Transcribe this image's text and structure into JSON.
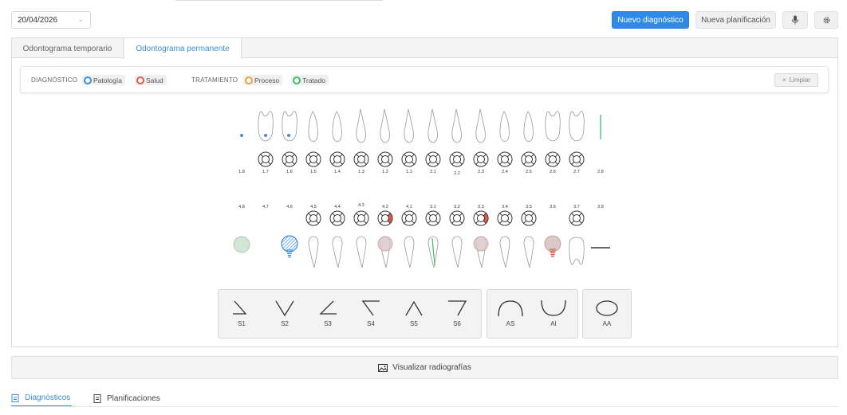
{
  "toolbar": {
    "date": "20/04/2026",
    "new_diagnosis": "Nuevo diagnóstico",
    "new_plan": "Nueva planificación",
    "mic_icon": "microphone-icon",
    "settings_icon": "gear-icon"
  },
  "tabs": {
    "temporary": "Odontograma temporario",
    "permanent": "Odontograma permanente"
  },
  "legend": {
    "diagnosis_title": "DIAGNÓSTICO",
    "pathology": "Patología",
    "health": "Salud",
    "treatment_title": "TRATAMIENTO",
    "process": "Proceso",
    "treated": "Tratado",
    "clear": "Limpiar",
    "colors": {
      "pathology": "#3a8fe0",
      "health": "#e05a4a",
      "process": "#e8a33a",
      "treated": "#3cbf6a"
    }
  },
  "upper_numbers": [
    "1.8",
    "1.7",
    "1.6",
    "1.5",
    "1.4",
    "1.3",
    "1.2",
    "1.1",
    "2.1",
    "2.2",
    "2.3",
    "2.4",
    "2.5",
    "2.6",
    "2.7",
    "2.8"
  ],
  "lower_numbers": [
    "4.8",
    "4.7",
    "4.6",
    "4.5",
    "4.4",
    "4.3",
    "4.2",
    "4.1",
    "3.1",
    "3.2",
    "3.3",
    "3.4",
    "3.5",
    "3.6",
    "3.7",
    "3.8"
  ],
  "symbols": {
    "group1": [
      "S1",
      "S2",
      "S3",
      "S4",
      "S5",
      "S6"
    ],
    "group2": [
      "AS",
      "AI"
    ],
    "group3": [
      "AA"
    ]
  },
  "radiographs": "Visualizar radiografías",
  "bottom_tabs": {
    "diagnostics": "Diagnósticos",
    "plans": "Planificaciones"
  }
}
